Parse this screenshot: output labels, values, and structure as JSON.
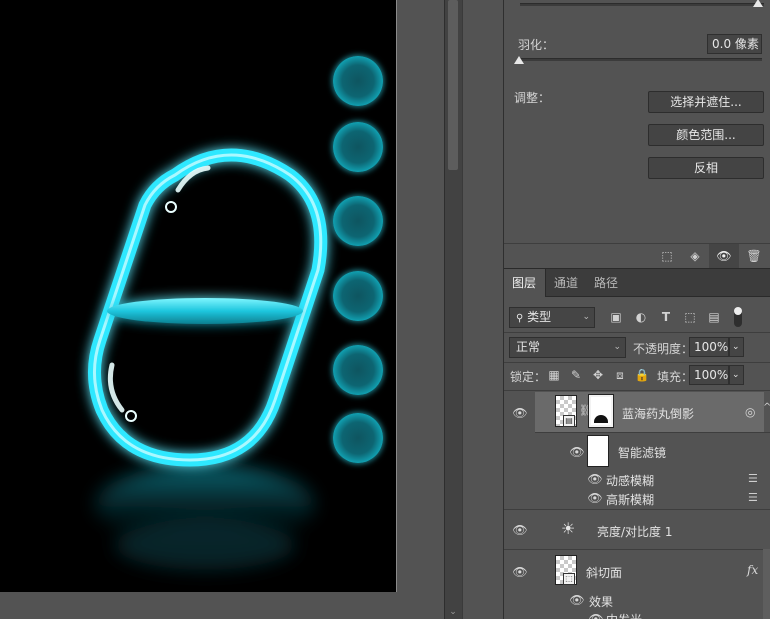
{
  "properties": {
    "feather_label": "羽化：",
    "feather_value": "0.0 像素",
    "adjust_label": "调整：",
    "buttons": [
      "选择并遮住...",
      "颜色范围...",
      "反相"
    ]
  },
  "layers_panel": {
    "tabs": [
      "图层",
      "通道",
      "路径"
    ],
    "filter_kind": "类型",
    "blend_mode": "正常",
    "opacity_label": "不透明度：",
    "opacity_value": "100%",
    "lock_label": "锁定：",
    "fill_label": "填充：",
    "fill_value": "100%",
    "layers": {
      "smart_object_name": "蓝海药丸倒影",
      "smart_filters_label": "智能滤镜",
      "filter_1": "动感模糊",
      "filter_2": "高斯模糊",
      "adjustment_name": "亮度/对比度 1",
      "bevel_layer_name": "斜切面",
      "effects_label": "效果",
      "effect_partial": "内发光",
      "fx_symbol": "fx"
    }
  },
  "colors": {
    "panel_bg": "#535353",
    "pill_glow": "#2ee8ff",
    "selected_layer": "#6a6a6a"
  }
}
